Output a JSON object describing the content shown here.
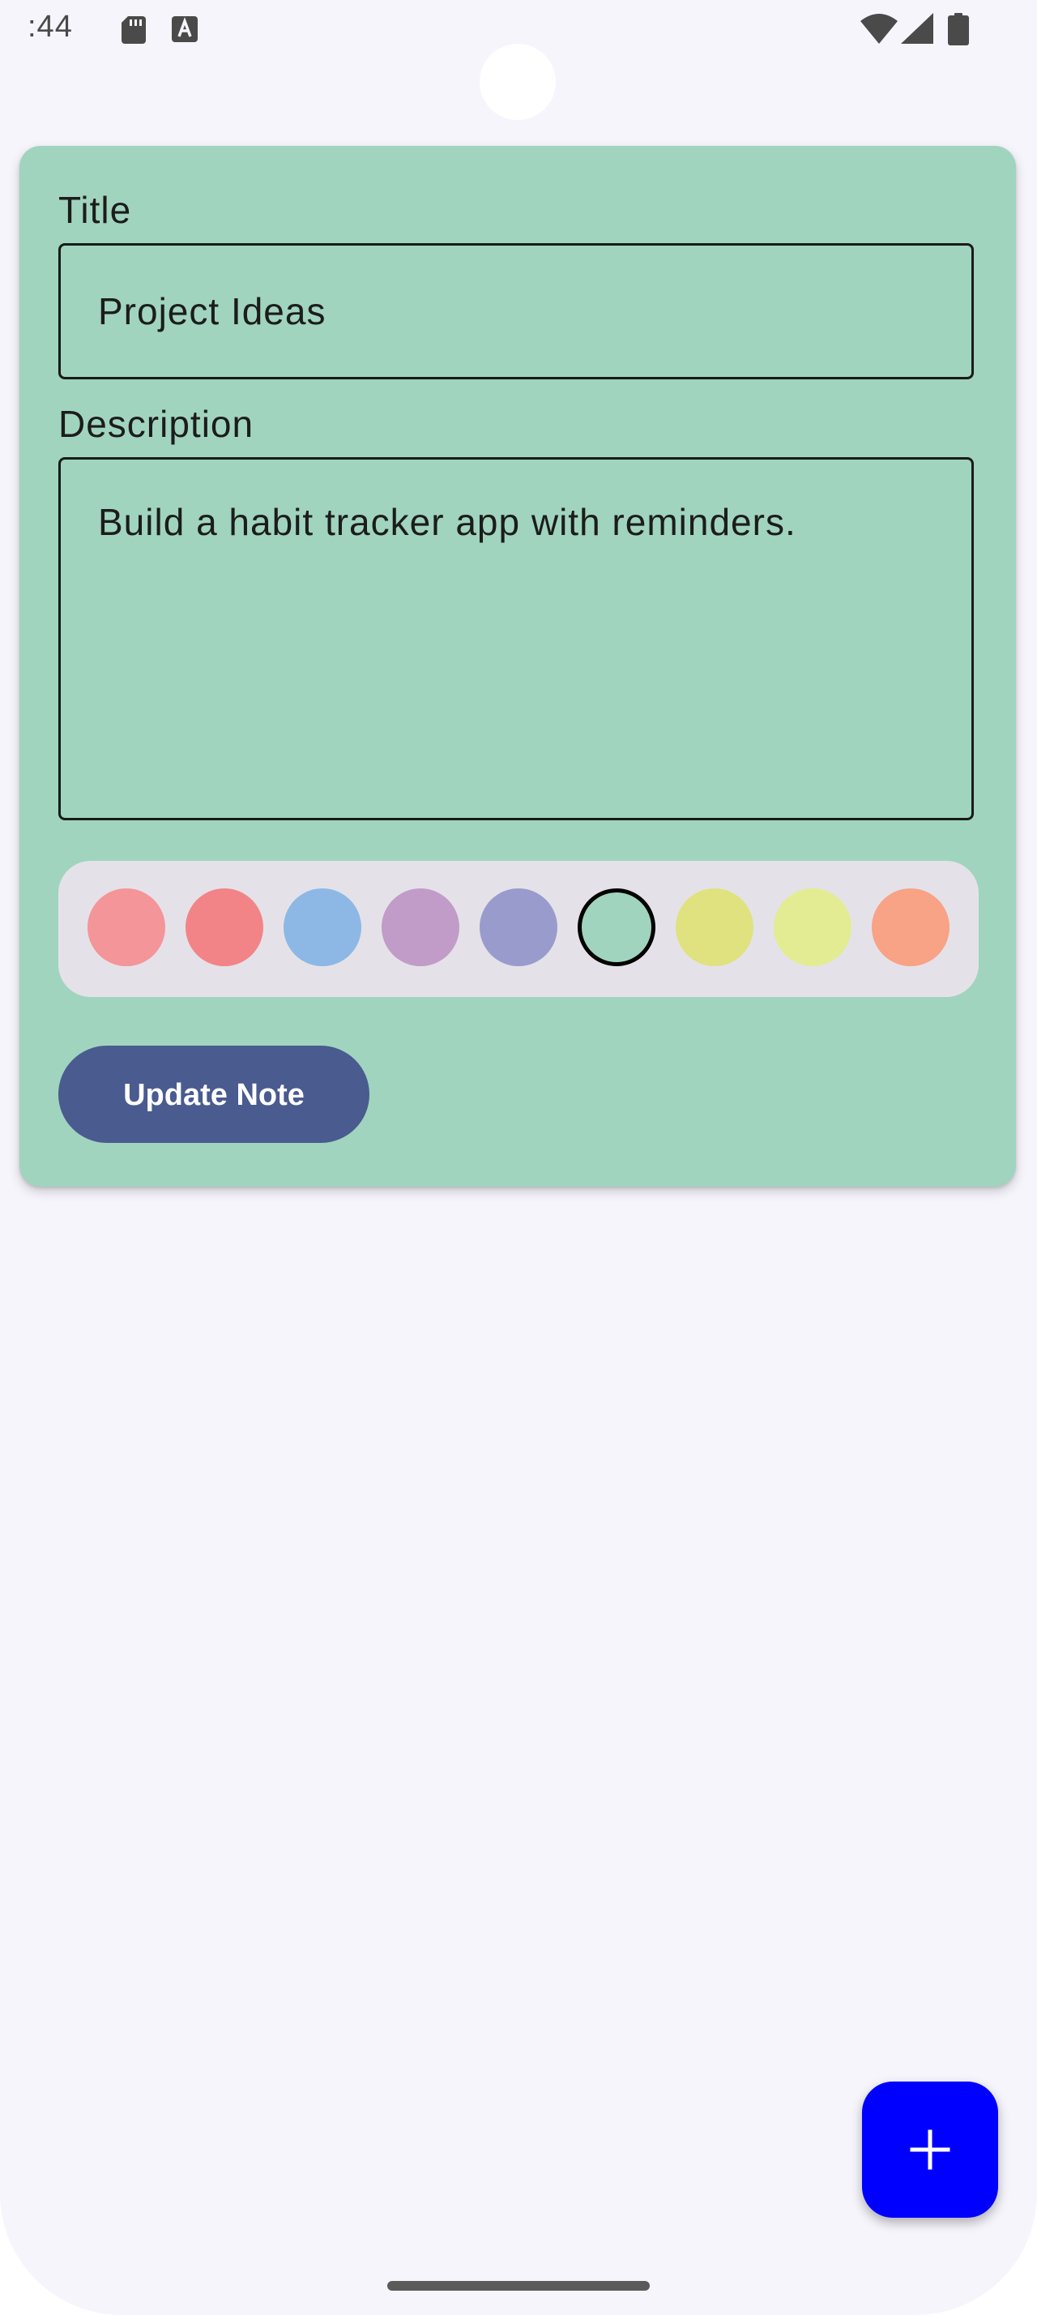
{
  "status_bar": {
    "time": ":44"
  },
  "note_form": {
    "title_label": "Title",
    "title_value": "Project Ideas",
    "description_label": "Description",
    "description_value": "Build a habit tracker app with reminders.",
    "update_button_label": "Update Note"
  },
  "colors": {
    "card_background": "#a0d4be",
    "selected_index": 5,
    "swatches": [
      "#f4959a",
      "#f28488",
      "#8db8e5",
      "#c19cc8",
      "#9a9bcd",
      "#a0d4be",
      "#dfe27f",
      "#e3ec93",
      "#f8a286"
    ],
    "button": "#495b8f",
    "fab": "#0000ff"
  },
  "fab": {
    "icon": "plus-icon"
  }
}
